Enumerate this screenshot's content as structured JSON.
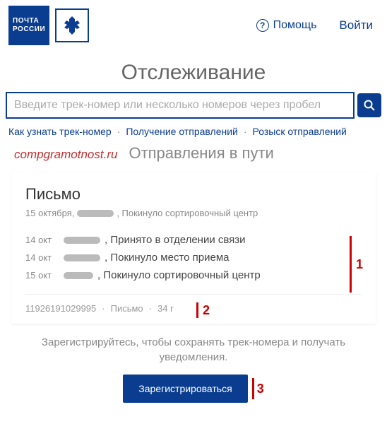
{
  "header": {
    "logo_line1": "ПОЧТА",
    "logo_line2": "РОССИИ",
    "help_label": "Помощь",
    "login_label": "Войти"
  },
  "page": {
    "title": "Отслеживание",
    "search_placeholder": "Введите трек-номер или несколько номеров через пробел"
  },
  "sublinks": {
    "how": "Как узнать трек-номер",
    "receive": "Получение отправлений",
    "search": "Розыск отправлений"
  },
  "watermark": "compgramotnost.ru",
  "section_title": "Отправления в пути",
  "card": {
    "title": "Письмо",
    "date_top": "15 октября,",
    "status_top": ", Покинуло сортировочный центр",
    "history": [
      {
        "date": "14 окт",
        "status": ", Принято в отделении связи"
      },
      {
        "date": "14 окт",
        "status": ", Покинуло место приема"
      },
      {
        "date": "15 окт",
        "status": ", Покинуло сортировочный центр"
      }
    ],
    "footer": {
      "track": "11926191029995",
      "type": "Письмо",
      "weight": "34 г"
    }
  },
  "annotations": {
    "a1": "1",
    "a2": "2",
    "a3": "3"
  },
  "promo": {
    "text": "Зарегистрируйтесь, чтобы сохранять трек-номера и получать уведомления.",
    "button": "Зарегистрироваться"
  }
}
